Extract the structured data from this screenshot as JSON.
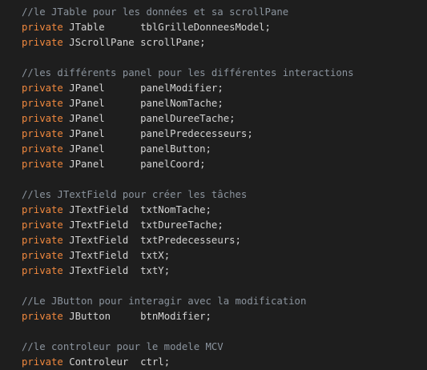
{
  "colors": {
    "background": "#1e1e1e",
    "comment": "#8b949e",
    "keyword": "#f0883e",
    "text": "#d4d4d4"
  },
  "lines": [
    {
      "kind": "comment",
      "text": "//le JTable pour les données et sa scrollPane"
    },
    {
      "kind": "decl",
      "keyword": "private",
      "type": "JTable",
      "name": "tblGrilleDonneesModel;"
    },
    {
      "kind": "decl",
      "keyword": "private",
      "type": "JScrollPane",
      "name": "scrollPane;"
    },
    {
      "kind": "blank"
    },
    {
      "kind": "comment",
      "text": "//les différents panel pour les différentes interactions"
    },
    {
      "kind": "decl",
      "keyword": "private",
      "type": "JPanel",
      "name": "panelModifier;"
    },
    {
      "kind": "decl",
      "keyword": "private",
      "type": "JPanel",
      "name": "panelNomTache;"
    },
    {
      "kind": "decl",
      "keyword": "private",
      "type": "JPanel",
      "name": "panelDureeTache;"
    },
    {
      "kind": "decl",
      "keyword": "private",
      "type": "JPanel",
      "name": "panelPredecesseurs;"
    },
    {
      "kind": "decl",
      "keyword": "private",
      "type": "JPanel",
      "name": "panelButton;"
    },
    {
      "kind": "decl",
      "keyword": "private",
      "type": "JPanel",
      "name": "panelCoord;"
    },
    {
      "kind": "blank"
    },
    {
      "kind": "comment",
      "text": "//les JTextField pour créer les tâches"
    },
    {
      "kind": "decl",
      "keyword": "private",
      "type": "JTextField",
      "name": "txtNomTache;"
    },
    {
      "kind": "decl",
      "keyword": "private",
      "type": "JTextField",
      "name": "txtDureeTache;"
    },
    {
      "kind": "decl",
      "keyword": "private",
      "type": "JTextField",
      "name": "txtPredecesseurs;"
    },
    {
      "kind": "decl",
      "keyword": "private",
      "type": "JTextField",
      "name": "txtX;"
    },
    {
      "kind": "decl",
      "keyword": "private",
      "type": "JTextField",
      "name": "txtY;"
    },
    {
      "kind": "blank"
    },
    {
      "kind": "comment",
      "text": "//Le JButton pour interagir avec la modification"
    },
    {
      "kind": "decl",
      "keyword": "private",
      "type": "JButton",
      "name": "btnModifier;"
    },
    {
      "kind": "blank"
    },
    {
      "kind": "comment",
      "text": "//le controleur pour le modele MCV"
    },
    {
      "kind": "decl",
      "keyword": "private",
      "type": "Controleur",
      "name": "ctrl;"
    }
  ]
}
